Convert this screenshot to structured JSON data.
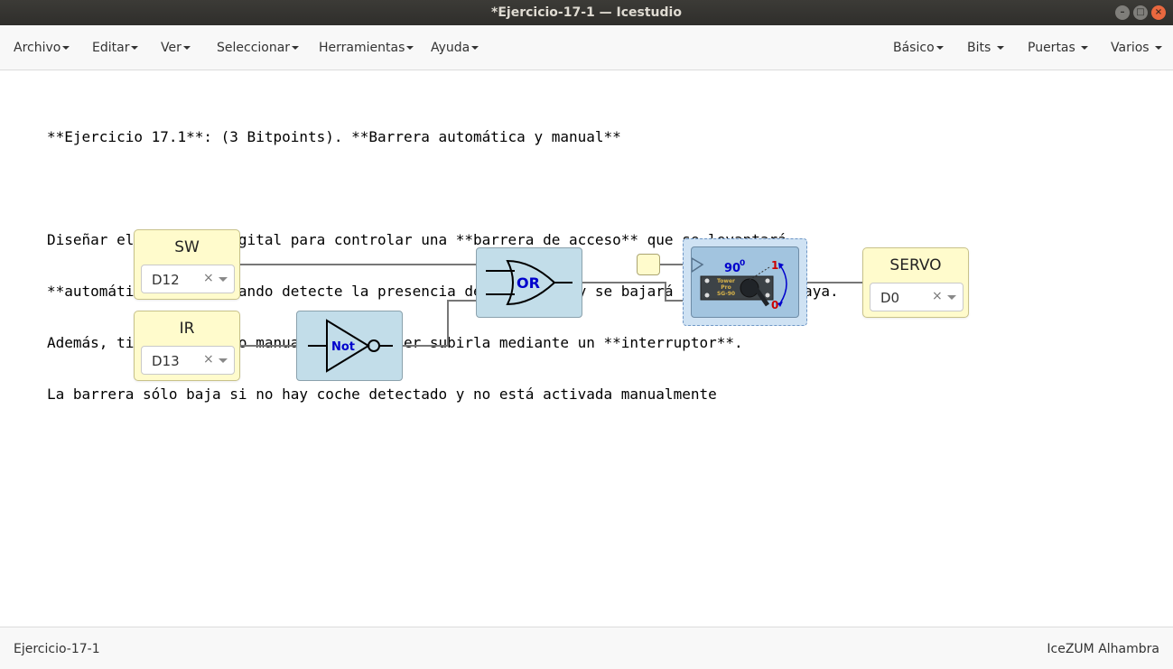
{
  "window": {
    "title": "*Ejercicio-17-1 — Icestudio",
    "controls": [
      "–",
      "□",
      "×"
    ]
  },
  "menubar": {
    "left": [
      "Archivo",
      "Editar",
      "Ver",
      "Seleccionar",
      "Herramientas",
      "Ayuda"
    ],
    "right": [
      "Básico",
      "Bits",
      "Puertas",
      "Varios"
    ]
  },
  "info": {
    "title_line": "**Ejercicio 17.1**: (3 Bitpoints). **Barrera automática y manual**",
    "body": [
      "Diseñar el circuito digital para controlar una **barrera de acceso** que se levantará",
      "**automáticamente** cuando detecte la presencia de un coche, y se bajará cuando no lo haya.",
      "Además, tiene un **modo manual** para poder subirla mediante un **interruptor**.",
      "La barrera sólo baja si no hay coche detectado y no está activada manualmente"
    ]
  },
  "circuit": {
    "inputs": [
      {
        "name": "SW",
        "pin": "D12",
        "clear": "×"
      },
      {
        "name": "IR",
        "pin": "D13",
        "clear": "×"
      }
    ],
    "output": {
      "name": "SERVO",
      "pin": "D0",
      "clear": "×"
    },
    "not_gate": {
      "label": "Not"
    },
    "or_gate": {
      "label": "OR"
    },
    "servo": {
      "angle": "90",
      "angle_mark": "0",
      "high": "1",
      "low": "0",
      "brand": [
        "Tower",
        "Pro",
        "SG-90"
      ]
    }
  },
  "statusbar": {
    "project": "Ejercicio-17-1",
    "board": "IceZUM Alhambra"
  },
  "colors": {
    "io_block": "#fffbcc",
    "logic_block": "#c2dde9",
    "servo_block": "#a2c4df",
    "gate_label": "#0000cc",
    "servo_high": "#cc0000",
    "wire": "#777777"
  }
}
